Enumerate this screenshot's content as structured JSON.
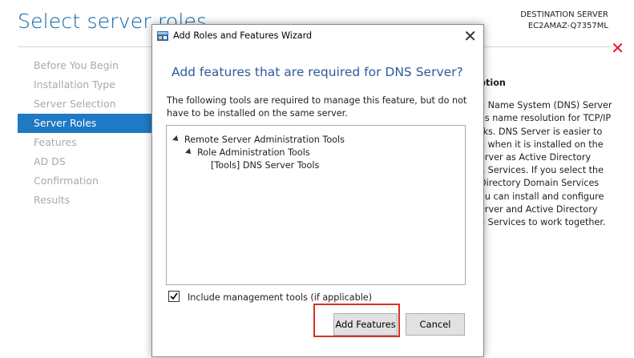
{
  "background": {
    "title": "Select server roles",
    "destination_label": "DESTINATION SERVER",
    "destination_server": "EC2AMAZ-Q7357ML",
    "nav": [
      {
        "label": "Before You Begin",
        "active": false
      },
      {
        "label": "Installation Type",
        "active": false
      },
      {
        "label": "Server Selection",
        "active": false
      },
      {
        "label": "Server Roles",
        "active": true
      },
      {
        "label": "Features",
        "active": false
      },
      {
        "label": "AD DS",
        "active": false
      },
      {
        "label": "Confirmation",
        "active": false
      },
      {
        "label": "Results",
        "active": false
      }
    ],
    "description_heading": "ption",
    "description_lines": [
      "n Name System (DNS) Server",
      "es name resolution for TCP/IP",
      "rks. DNS Server is easier to",
      "e when it is installed on the",
      "erver as Active Directory",
      "n Services. If you select the",
      "Directory Domain Services",
      "ou can install and configure",
      "erver and Active Directory",
      "n Services to work together."
    ]
  },
  "dialog": {
    "title": "Add Roles and Features Wizard",
    "heading": "Add features that are required for DNS Server?",
    "description": "The following tools are required to manage this feature, but do not have to be installed on the same server.",
    "tree": [
      {
        "label": "Remote Server Administration Tools",
        "level": 0,
        "expanded": true
      },
      {
        "label": "Role Administration Tools",
        "level": 1,
        "expanded": true
      },
      {
        "label": "[Tools] DNS Server Tools",
        "level": 2,
        "expanded": false
      }
    ],
    "include_tools_label": "Include management tools (if applicable)",
    "include_tools_checked": true,
    "add_features_label": "Add Features",
    "cancel_label": "Cancel"
  },
  "colors": {
    "accent": "#1f79c4",
    "title": "#0a64a4",
    "highlight": "#d93025",
    "close": "#e81123"
  }
}
